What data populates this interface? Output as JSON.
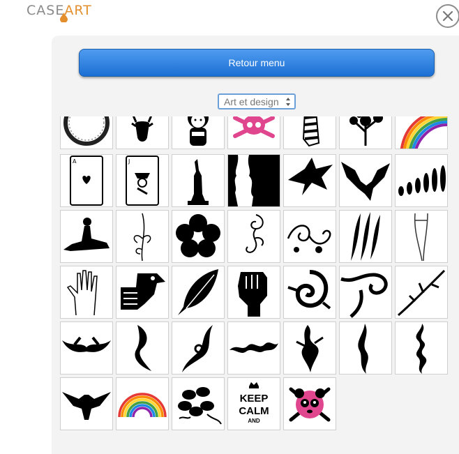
{
  "app": {
    "logo_case": "CASE",
    "logo_art": "ART"
  },
  "toolbar": {
    "menu_label": "Retour menu"
  },
  "category": {
    "selected": "Art et design"
  },
  "gallery": {
    "rows": [
      [
        "ring",
        "deer-head",
        "kokeshi-doll",
        "skull-crossbones-pink",
        "zebra",
        "splatter-tree",
        "rainbow-arc"
      ],
      [
        "ace-of-hearts",
        "jack-card",
        "statue-of-liberty",
        "silhouette-faces",
        "dragon",
        "bat-dragon",
        "human-evolution"
      ],
      [
        "pinup-silhouette",
        "lily-flower",
        "plum-flower",
        "swirl-ornament",
        "floral-swirl",
        "claw-scratch",
        "legs-sketch"
      ],
      [
        "hand",
        "aztec-eagle",
        "feather",
        "raised-fist",
        "tribal-spiral",
        "tribal-wave",
        "tribal-branch"
      ],
      [
        "tribal-horns",
        "tribal-vertical",
        "tribal-curve",
        "tribal-band",
        "tribal-flame",
        "tribal-blade",
        "tribal-totem"
      ],
      [
        "eagle",
        "rainbow",
        "hibiscus",
        "keep-calm",
        "panda-skull"
      ]
    ],
    "keep_calm": {
      "line1": "KEEP",
      "line2": "CALM",
      "line3": "AND"
    }
  },
  "colors": {
    "accent": "#1c6fd3",
    "logo_orange": "#e48f2d",
    "pink": "#e0468e",
    "panel": "#f3f3f3"
  }
}
